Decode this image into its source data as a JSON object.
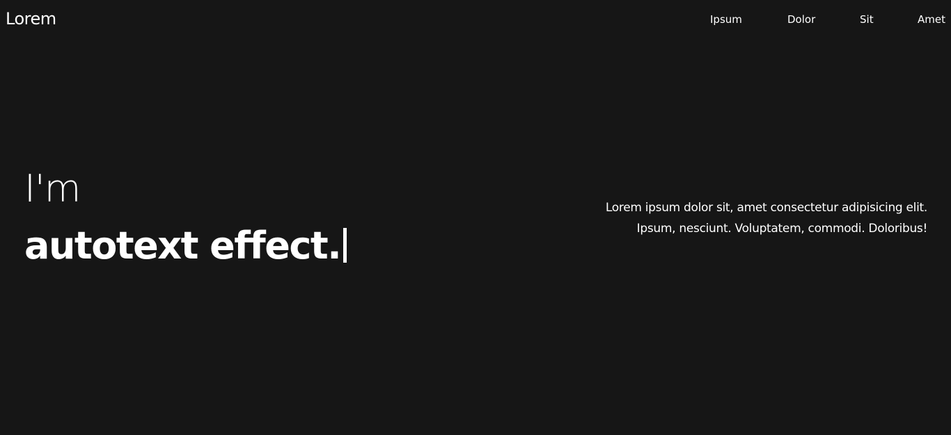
{
  "header": {
    "logo": "Lorem",
    "nav": [
      "Ipsum",
      "Dolor",
      "Sit",
      "Amet"
    ]
  },
  "hero": {
    "line1": "I'm",
    "line2": "autotext effect."
  },
  "description": {
    "line1": "Lorem ipsum dolor sit, amet consectetur adipisicing elit.",
    "line2": "Ipsum, nesciunt. Voluptatem, commodi. Doloribus!"
  },
  "colors": {
    "background": "#161616",
    "text": "#ffffff"
  }
}
